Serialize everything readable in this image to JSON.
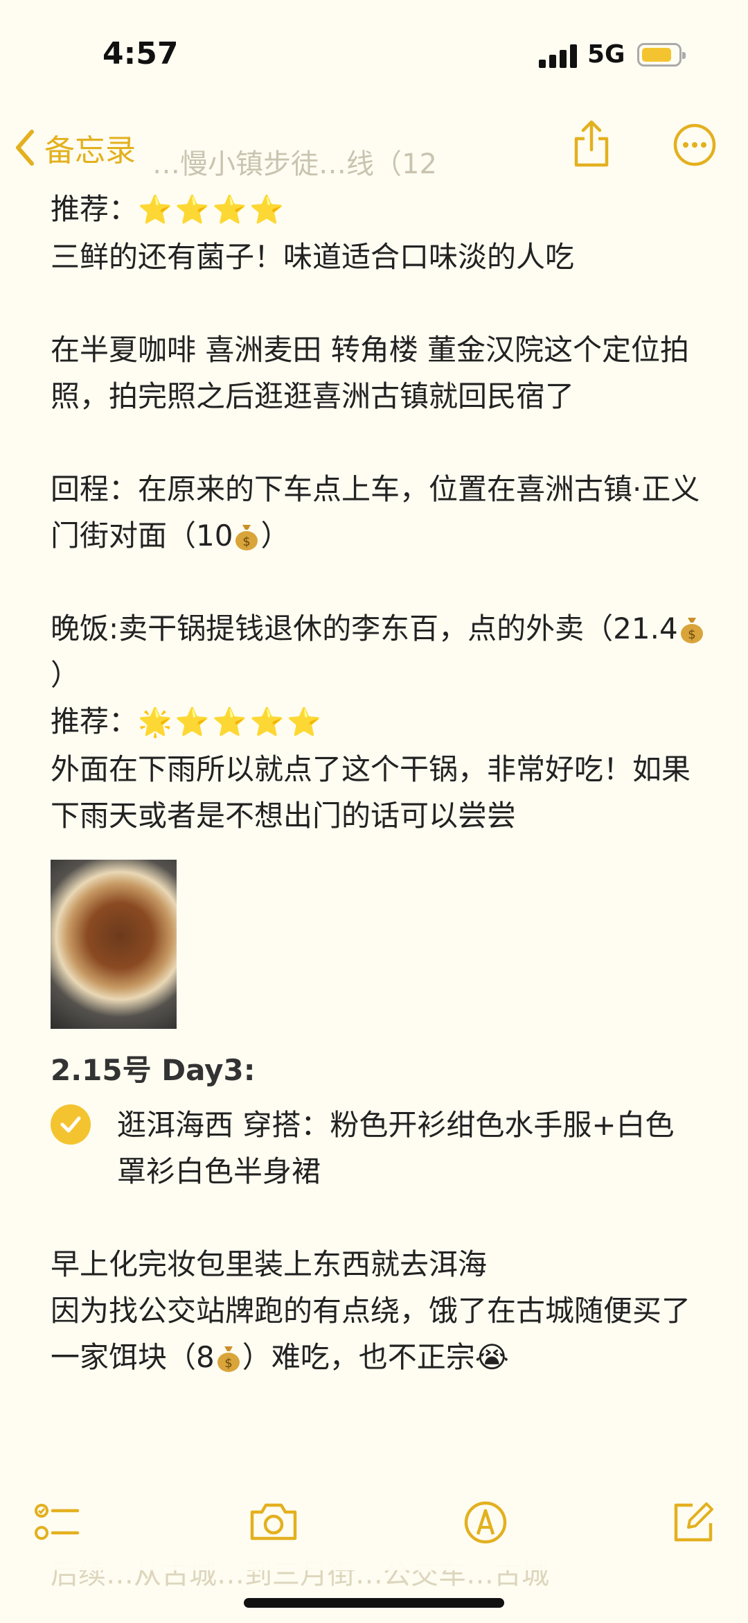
{
  "status": {
    "time": "4:57",
    "network": "5G"
  },
  "nav": {
    "back_label": "备忘录",
    "ghost_title": "…慢小镇步徒…线（12"
  },
  "note": {
    "rec1_label": "推荐：",
    "rec1_stars": "⭐⭐⭐⭐",
    "p1": "三鲜的还有菌子！味道适合口味淡的人吃",
    "p2": "在半夏咖啡 喜洲麦田 转角楼 董金汉院这个定位拍照，拍完照之后逛逛喜洲古镇就回民宿了",
    "p3a": "回程：在原来的下车点上车，位置在喜洲古镇·正义门街对面（10",
    "p3b": "）",
    "p4a": "晚饭:卖干锅提钱退休的李东百，点的外卖（21.4",
    "p4b": "）",
    "rec2_label": "推荐：",
    "rec2_spark": "🌟",
    "rec2_stars": "⭐⭐⭐⭐",
    "p5": "外面在下雨所以就点了这个干锅，非常好吃！如果下雨天或者是不想出门的话可以尝尝",
    "day3_heading": "2.15号 Day3:",
    "check_item": "逛洱海西 穿搭：粉色开衫绀色水手服+白色罩衫白色半身裙",
    "p6": "早上化完妆包里装上东西就去洱海",
    "p7a": "因为找公交站牌跑的有点绕，饿了在古城随便买了一家饵块（8",
    "p7b": "）难吃，也不正宗😭",
    "faded_text": "后续…从古城…到三月街…公交车…古城"
  },
  "toolbar": {
    "checklist": "checklist-icon",
    "camera": "camera-icon",
    "markup": "markup-icon",
    "compose": "compose-icon"
  },
  "colors": {
    "accent": "#e3b01f",
    "background": "#fffdf2",
    "text": "#222222"
  }
}
